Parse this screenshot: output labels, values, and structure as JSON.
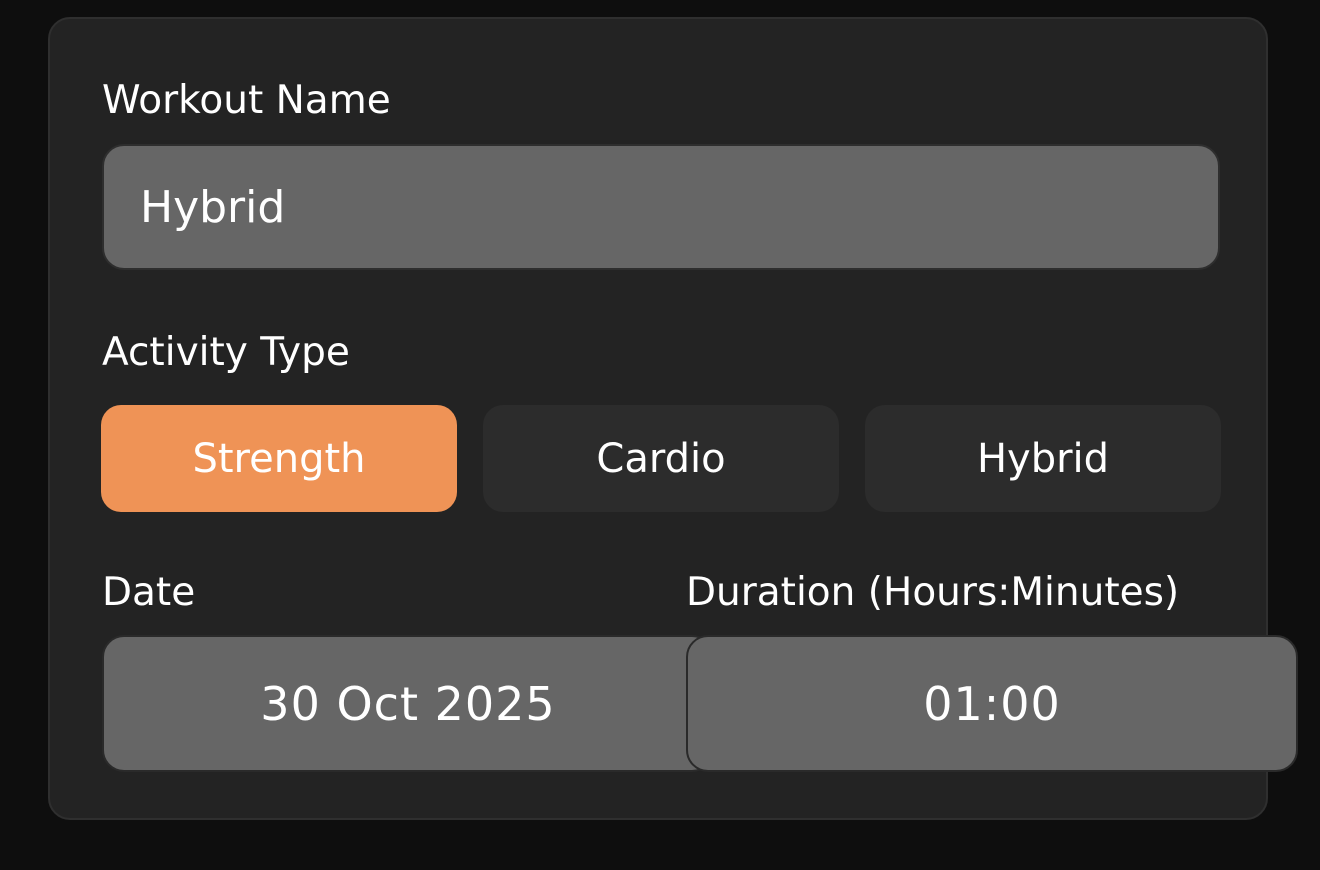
{
  "form": {
    "workout_name_label": "Workout Name",
    "workout_name_value": "Hybrid",
    "activity_type_label": "Activity Type",
    "activity_types": [
      {
        "label": "Strength",
        "selected": true
      },
      {
        "label": "Cardio",
        "selected": false
      },
      {
        "label": "Hybrid",
        "selected": false
      }
    ],
    "date_label": "Date",
    "date_value": "30 Oct 2025",
    "duration_label": "Duration (Hours:Minutes)",
    "duration_value": "01:00"
  },
  "colors": {
    "background": "#0e0e0e",
    "card": "#232323",
    "input": "#666666",
    "segment": "#2c2c2c",
    "accent": "#ef9356"
  }
}
